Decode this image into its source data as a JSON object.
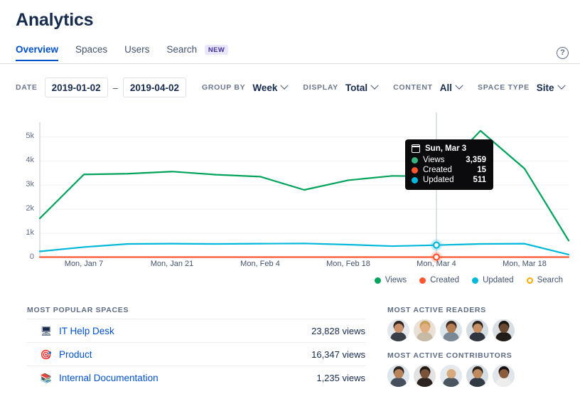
{
  "header": {
    "title": "Analytics",
    "help_icon": "question-circle-icon"
  },
  "tabs": [
    {
      "label": "Overview",
      "active": true,
      "badge": null
    },
    {
      "label": "Spaces",
      "active": false,
      "badge": null
    },
    {
      "label": "Users",
      "active": false,
      "badge": null
    },
    {
      "label": "Search",
      "active": false,
      "badge": "NEW"
    }
  ],
  "filters": {
    "date_label": "DATE",
    "date_from": "2019-01-02",
    "date_to": "2019-04-02",
    "date_separator": "–",
    "group_by_label": "GROUP BY",
    "group_by_value": "Week",
    "display_label": "DISPLAY",
    "display_value": "Total",
    "content_label": "CONTENT",
    "content_value": "All",
    "space_type_label": "SPACE TYPE",
    "space_type_value": "Site"
  },
  "chart_data": {
    "type": "line",
    "title": "",
    "xlabel": "",
    "ylabel": "",
    "ylim": [
      0,
      5600
    ],
    "ytick_labels": [
      "0",
      "1k",
      "2k",
      "3k",
      "4k",
      "5k"
    ],
    "ytick_values": [
      0,
      1000,
      2000,
      3000,
      4000,
      5000
    ],
    "xtick_labels": [
      "Mon, Jan 7",
      "Mon, Jan 21",
      "Mon, Feb 4",
      "Mon, Feb 18",
      "Mon, Mar 4",
      "Mon, Mar 18"
    ],
    "xtick_indices": [
      1,
      3,
      5,
      7,
      9,
      11
    ],
    "x": [
      "Dec 31",
      "Jan 7",
      "Jan 14",
      "Jan 21",
      "Jan 28",
      "Feb 4",
      "Feb 11",
      "Feb 18",
      "Feb 25",
      "Mar 4",
      "Mar 11",
      "Mar 18",
      "Mar 25"
    ],
    "grid": true,
    "legend_position": "bottom-right",
    "series": [
      {
        "name": "Views",
        "color": "#00A35C",
        "values": [
          1620,
          3440,
          3470,
          3560,
          3430,
          3350,
          2800,
          3200,
          3380,
          3359,
          5250,
          3680,
          700
        ]
      },
      {
        "name": "Created",
        "color": "#FF5630",
        "values": [
          15,
          15,
          15,
          15,
          15,
          15,
          15,
          15,
          15,
          15,
          15,
          15,
          15
        ]
      },
      {
        "name": "Updated",
        "color": "#00B8D9",
        "values": [
          250,
          430,
          560,
          570,
          560,
          570,
          580,
          530,
          470,
          511,
          560,
          570,
          120
        ]
      },
      {
        "name": "Search",
        "color": "#FFAB00",
        "values": []
      }
    ],
    "hover": {
      "index": 9,
      "date": "Sun, Mar 3",
      "rows": [
        {
          "label": "Views",
          "value": "3,359",
          "color": "#36B37E"
        },
        {
          "label": "Created",
          "value": "15",
          "color": "#FF5630"
        },
        {
          "label": "Updated",
          "value": "511",
          "color": "#00B8D9"
        }
      ]
    },
    "legend": [
      {
        "label": "Views",
        "color": "#00A35C",
        "filled": true
      },
      {
        "label": "Created",
        "color": "#FF5630",
        "filled": true
      },
      {
        "label": "Updated",
        "color": "#00B8D9",
        "filled": true
      },
      {
        "label": "Search",
        "color": "#FFAB00",
        "filled": false
      }
    ]
  },
  "popular_spaces": {
    "title": "MOST POPULAR SPACES",
    "rows": [
      {
        "icon": "monitor-icon",
        "glyph": "🖥",
        "name": "IT Help Desk",
        "views": "23,828 views"
      },
      {
        "icon": "target-icon",
        "glyph": "🎯",
        "name": "Product",
        "views": "16,347 views"
      },
      {
        "icon": "books-icon",
        "glyph": "📚",
        "name": "Internal Documentation",
        "views": "1,235 views"
      }
    ]
  },
  "active_readers": {
    "title": "MOST ACTIVE READERS",
    "avatars": [
      {
        "bg": "#E4E8EC",
        "skin": "#C8906A",
        "hair": "#2E2622",
        "shirt": "#3A3F47"
      },
      {
        "bg": "#E9E1D6",
        "skin": "#E0B083",
        "hair": "#C9A05A",
        "shirt": "#C7BBA8"
      },
      {
        "bg": "#DCE5EA",
        "skin": "#B67C52",
        "hair": "#3A2C24",
        "shirt": "#7A8794"
      },
      {
        "bg": "#D5DDE3",
        "skin": "#C58F63",
        "hair": "#2B2420",
        "shirt": "#2F3640"
      },
      {
        "bg": "#D9DEE3",
        "skin": "#6B4A33",
        "hair": "#1C1613",
        "shirt": "#221C18"
      }
    ]
  },
  "active_contributors": {
    "title": "MOST ACTIVE CONTRIBUTORS",
    "avatars": [
      {
        "bg": "#DDE6EB",
        "skin": "#B9835A",
        "hair": "#2D2520",
        "shirt": "#45505C"
      },
      {
        "bg": "#E2E2E2",
        "skin": "#7A5238",
        "hair": "#201915",
        "shirt": "#2A2320"
      },
      {
        "bg": "#E3EAEF",
        "skin": "#D6A97E",
        "hair": "#E8E8E8",
        "shirt": "#4A5560"
      },
      {
        "bg": "#D6DEE4",
        "skin": "#C08A5F",
        "hair": "#2A2420",
        "shirt": "#323A44"
      },
      {
        "bg": "#E0E5E9",
        "skin": "#8A5C3C",
        "hair": "#171211",
        "shirt": "#EDEDED"
      }
    ]
  }
}
